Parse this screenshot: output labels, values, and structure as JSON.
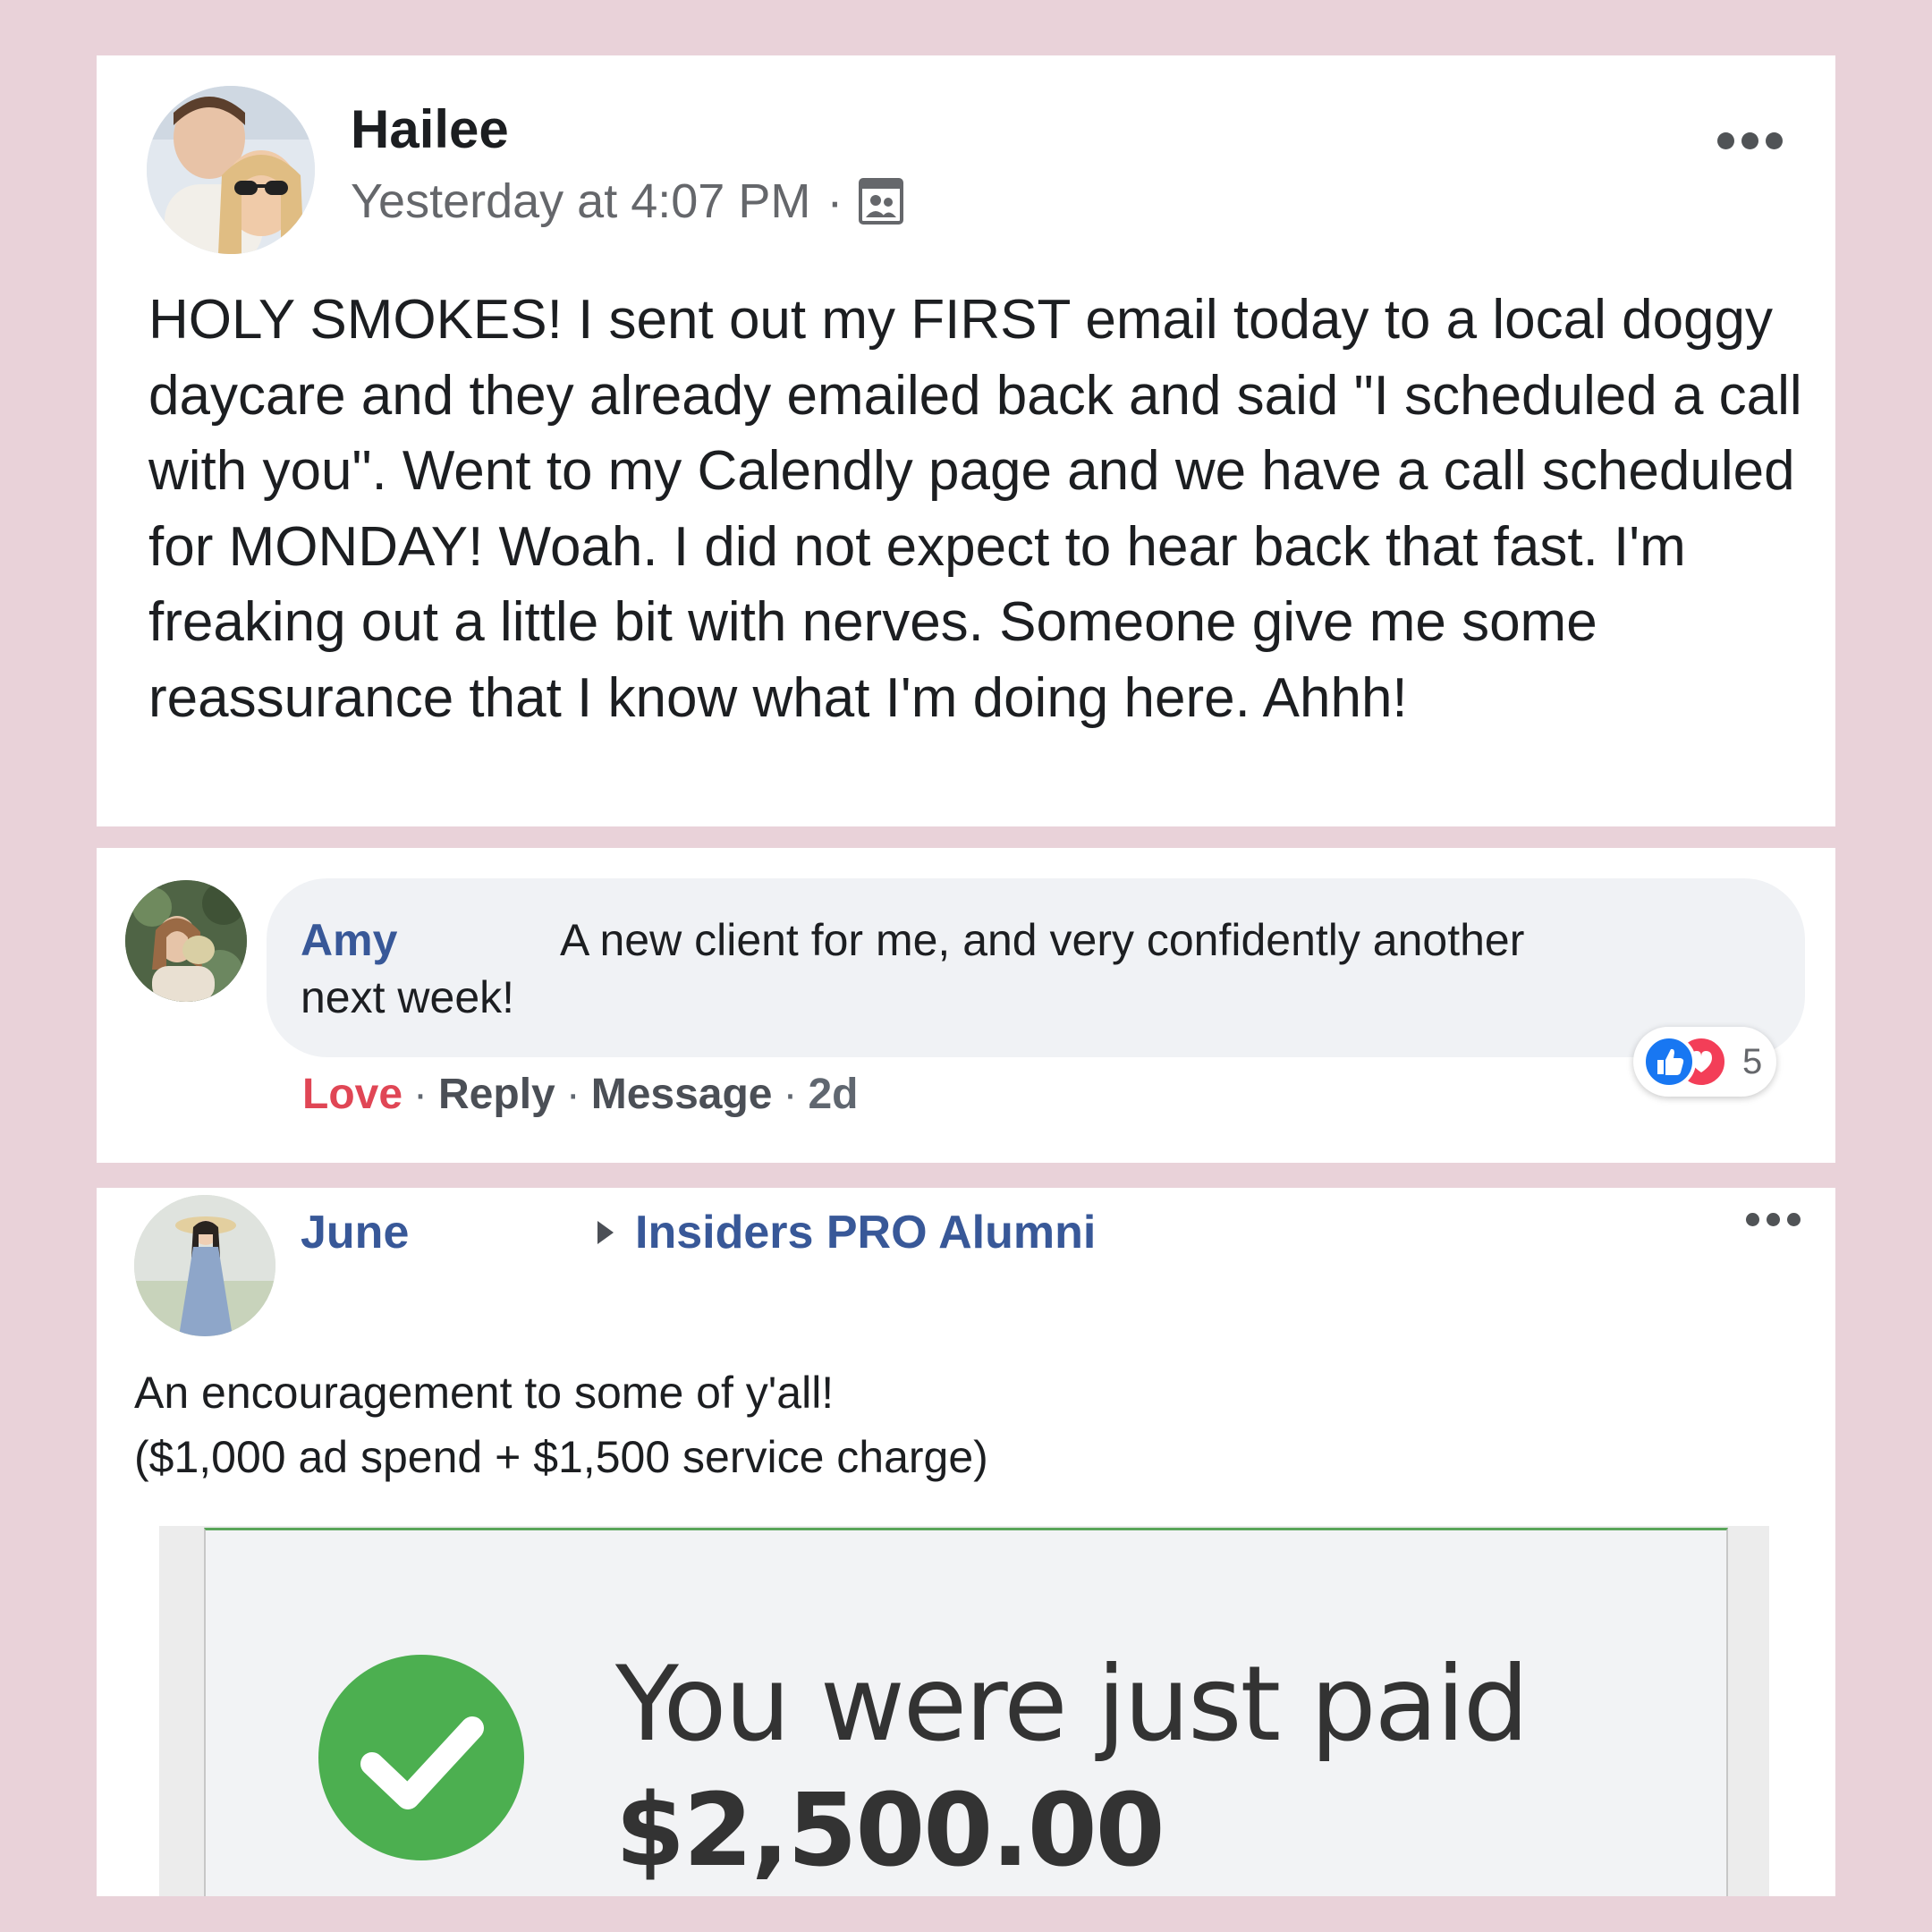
{
  "post1": {
    "author": "Hailee",
    "time": "Yesterday at 4:07 PM",
    "separator": "·",
    "audience_icon": "group-audience-icon",
    "text": "HOLY SMOKES! I sent out my FIRST email today to a local doggy daycare and they already emailed back and said \"I scheduled a call with you\". Went to my Calendly page and we have a call scheduled for MONDAY! Woah. I did not expect to hear back that fast. I'm freaking out a little bit with nerves. Someone give me some reassurance that I know what I'm doing here. Ahhh!"
  },
  "comment": {
    "author": "Amy",
    "text_line1": "A new client for me, and very confidently another",
    "text_line2": "next week!",
    "actions": {
      "love": "Love",
      "reply": "Reply",
      "message": "Message",
      "age": "2d",
      "separator": "·"
    },
    "reactions": {
      "types": [
        "like",
        "love"
      ],
      "count": "5"
    }
  },
  "post2": {
    "author": "June",
    "group": "Insiders PRO Alumni",
    "text_line1": "An encouragement to some of y'all!",
    "text_line2": "($1,000 ad spend + $1,500 service charge)",
    "payment": {
      "title": "You were just paid",
      "amount": "$2,500.00",
      "icon": "check-circle-icon"
    }
  },
  "colors": {
    "background": "#e9d2d9",
    "card": "#ffffff",
    "link_blue": "#385898",
    "love_red": "#e04655",
    "like_blue": "#1877f2",
    "check_green": "#4caf50"
  }
}
